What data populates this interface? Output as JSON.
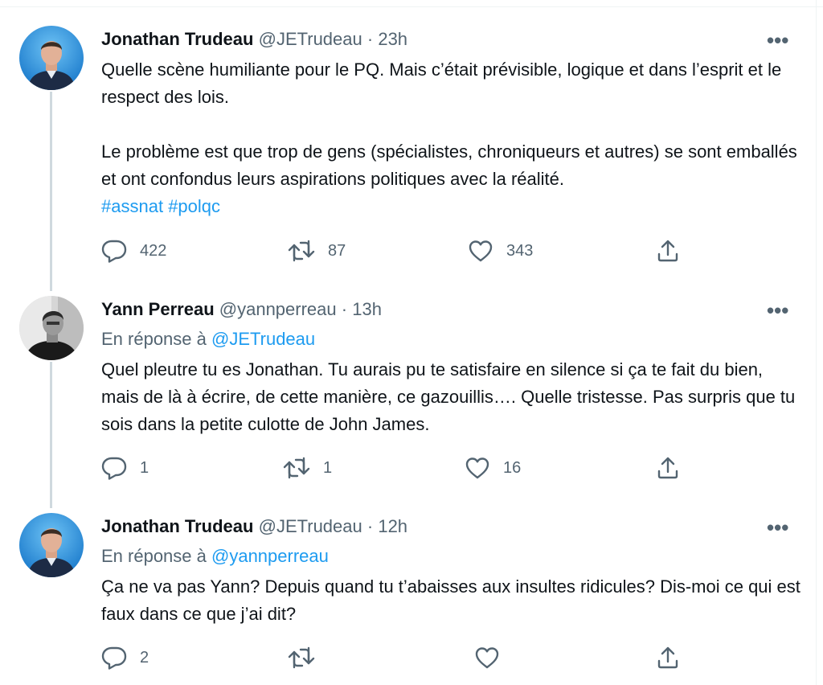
{
  "tweets": [
    {
      "name": "Jonathan Trudeau",
      "handle": "@JETrudeau",
      "sep": "·",
      "time": "23h",
      "more": "•••",
      "reply_prefix": "",
      "reply_handle": "",
      "paragraphs": [
        "Quelle scène humiliante pour le PQ. Mais c’était prévisible, logique et dans l’esprit et le respect des lois.",
        "Le problème est que trop de gens (spécialistes, chroniqueurs et autres) se sont emballés et ont confondus leurs aspirations politiques avec la réalité."
      ],
      "hashtags": [
        "#assnat",
        "#polqc"
      ],
      "replies": "422",
      "retweets": "87",
      "likes": "343"
    },
    {
      "name": "Yann Perreau",
      "handle": "@yannperreau",
      "sep": "·",
      "time": "13h",
      "more": "•••",
      "reply_prefix": "En réponse à",
      "reply_handle": "@JETrudeau",
      "paragraphs": [
        "Quel pleutre tu es Jonathan. Tu aurais pu te satisfaire en silence si ça te fait du bien, mais de là à écrire, de cette manière, ce gazouillis…. Quelle tristesse. Pas surpris que tu sois dans la petite culotte de John James."
      ],
      "hashtags": [],
      "replies": "1",
      "retweets": "1",
      "likes": "16"
    },
    {
      "name": "Jonathan Trudeau",
      "handle": "@JETrudeau",
      "sep": "·",
      "time": "12h",
      "more": "•••",
      "reply_prefix": "En réponse à",
      "reply_handle": "@yannperreau",
      "paragraphs": [
        "Ça ne va pas Yann? Depuis quand tu t’abaisses aux insultes ridicules? Dis-moi ce qui est faux dans ce que j’ai dit?"
      ],
      "hashtags": [],
      "replies": "2",
      "retweets": "",
      "likes": ""
    }
  ],
  "colors": {
    "accent": "#1d9bf0",
    "secondary_text": "#536471",
    "thread_line": "#cfd9de"
  },
  "icons": [
    "reply-icon",
    "retweet-icon",
    "like-icon",
    "share-icon",
    "more-icon"
  ]
}
